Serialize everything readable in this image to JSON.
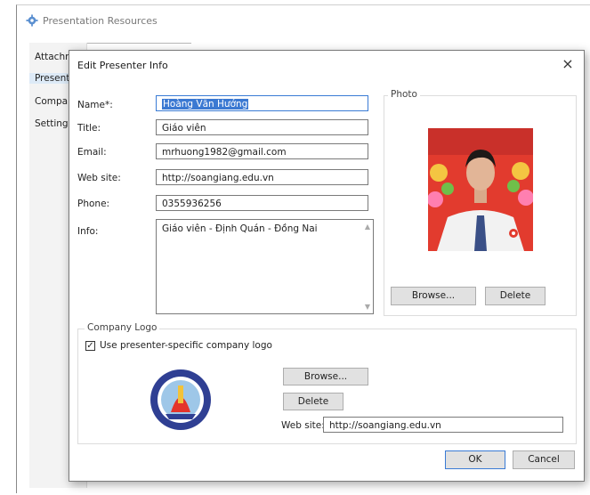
{
  "outer_window": {
    "title": "Presentation Resources",
    "tabs": [
      {
        "label": "Attachm",
        "selected": false
      },
      {
        "label": "Present",
        "selected": true
      },
      {
        "label": "Compar",
        "selected": false
      },
      {
        "label": "Settings",
        "selected": false
      }
    ]
  },
  "dialog": {
    "title": "Edit Presenter Info",
    "close_glyph": "×",
    "fields": {
      "name": {
        "label": "Name*:",
        "value": "Hoàng Văn Hướng"
      },
      "title": {
        "label": "Title:",
        "value": "Giáo viên"
      },
      "email": {
        "label": "Email:",
        "value": "mrhuong1982@gmail.com"
      },
      "website": {
        "label": "Web site:",
        "value": "http://soangiang.edu.vn"
      },
      "phone": {
        "label": "Phone:",
        "value": "0355936256"
      },
      "info": {
        "label": "Info:",
        "value": "Giáo viên - Định Quán - Đồng Nai"
      }
    },
    "photo": {
      "group_label": "Photo",
      "browse_label": "Browse...",
      "delete_label": "Delete"
    },
    "company_logo": {
      "group_label": "Company Logo",
      "checkbox_label": "Use presenter-specific company logo",
      "checked": true,
      "browse_label": "Browse...",
      "delete_label": "Delete",
      "website_label": "Web site:",
      "website_value": "http://soangiang.edu.vn"
    },
    "ok_label": "OK",
    "cancel_label": "Cancel"
  },
  "colors": {
    "accent": "#3b79d2",
    "photo_background": "#e23b2e",
    "shirt": "#f2f2f2",
    "tie": "#3a4f86"
  },
  "icons": [
    "gear-icon",
    "close-icon",
    "checkbox-check-icon",
    "scroll-up-icon",
    "scroll-down-icon",
    "school-logo-seal"
  ]
}
